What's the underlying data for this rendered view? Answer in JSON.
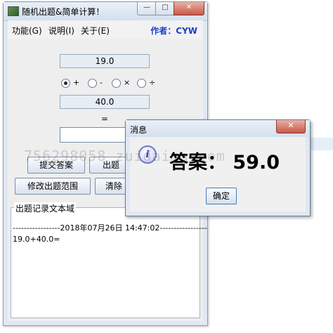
{
  "window": {
    "title": "随机出题&简单计算！",
    "minimize_glyph": "—",
    "maximize_glyph": "□",
    "close_glyph": "✕"
  },
  "menu": {
    "items": [
      "功能(G)",
      "说明(I)",
      "关于(E)"
    ],
    "author": "作者：CYW"
  },
  "form": {
    "operand_a": "19.0",
    "operand_b": "40.0",
    "operators": [
      {
        "symbol": "+",
        "selected": true
      },
      {
        "symbol": "-",
        "selected": false
      },
      {
        "symbol": "×",
        "selected": false
      },
      {
        "symbol": "÷",
        "selected": false
      }
    ],
    "equals": "=",
    "answer": ""
  },
  "buttons": {
    "submit": "提交答案",
    "generate": "出题",
    "change_range": "修改出题范围",
    "clear": "清除"
  },
  "record": {
    "legend": "出题记录文本域",
    "lines": [
      "-----------------2018年07月26日 14:47:02-----------------",
      "19.0+40.0="
    ]
  },
  "dialog": {
    "title": "消息",
    "message": "答案：  59.0",
    "ok": "确定",
    "close_glyph": "✕",
    "icon": "info-icon"
  },
  "watermark": "756298058 zuidaima com"
}
